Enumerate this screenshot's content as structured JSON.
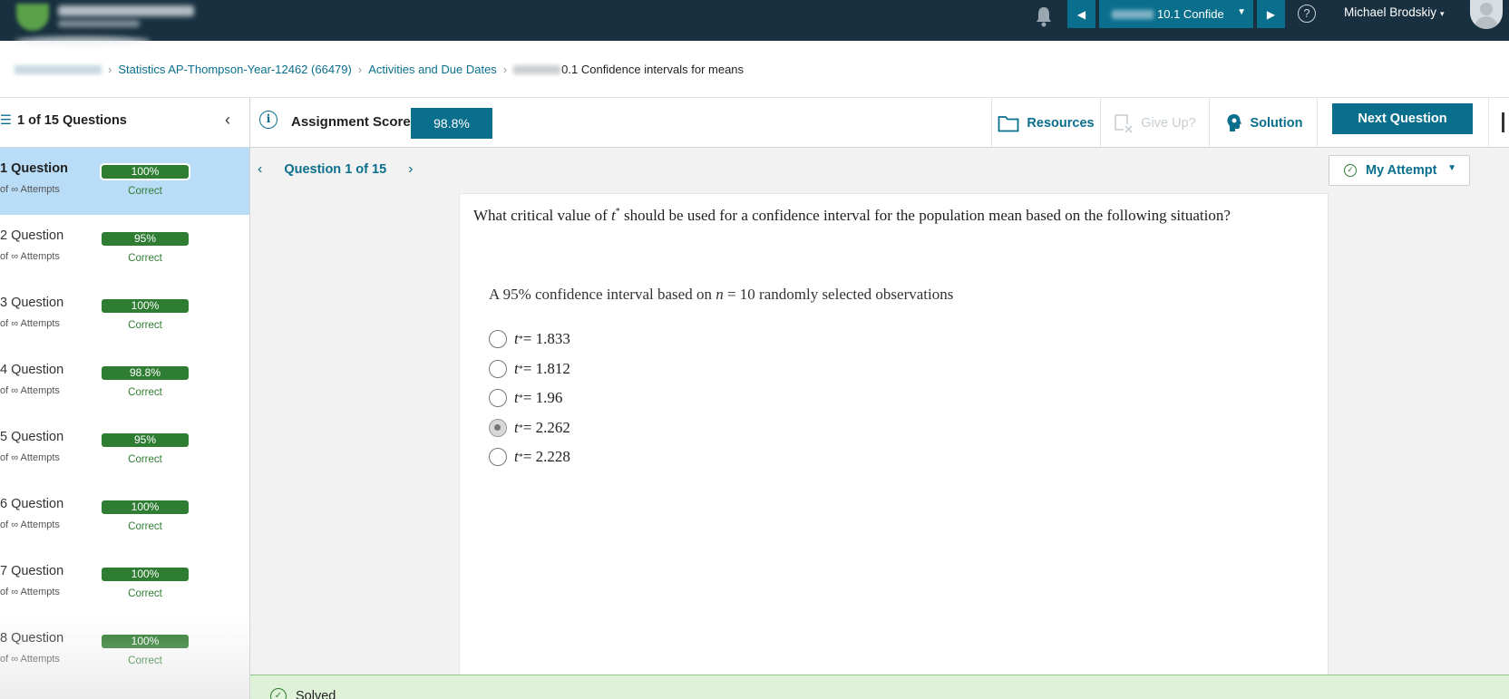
{
  "topbar": {
    "logo_name": "cengage-logo",
    "assignment_title": "10.1 Confide",
    "assignment_caret": "▼",
    "prev_icon": "◀",
    "next_icon": "▶",
    "help_icon": "?",
    "user_name": "Michael Brodskiy",
    "user_caret": "▾"
  },
  "breadcrumb": {
    "course": "Statistics AP-Thompson-Year-12462 (66479)",
    "activities": "Activities and Due Dates",
    "current": "0.1 Confidence intervals for means",
    "separator": "›"
  },
  "header": {
    "question_count": "1 of 15 Questions",
    "menu_icon": "☰",
    "collapse_icon": "‹",
    "info_icon": "i",
    "score_label": "Assignment Score:",
    "score_value": "98.8%",
    "resources_label": "Resources",
    "giveup_label": "Give Up?",
    "solution_label": "Solution",
    "next_question_label": "Next Question"
  },
  "sidebar": {
    "items": [
      {
        "name": "1 Question",
        "attempts": "of ∞ Attempts",
        "score": "100%",
        "status": "Correct"
      },
      {
        "name": "2 Question",
        "attempts": "of ∞ Attempts",
        "score": "95%",
        "status": "Correct"
      },
      {
        "name": "3 Question",
        "attempts": "of ∞ Attempts",
        "score": "100%",
        "status": "Correct"
      },
      {
        "name": "4 Question",
        "attempts": "of ∞ Attempts",
        "score": "98.8%",
        "status": "Correct"
      },
      {
        "name": "5 Question",
        "attempts": "of ∞ Attempts",
        "score": "95%",
        "status": "Correct"
      },
      {
        "name": "6 Question",
        "attempts": "of ∞ Attempts",
        "score": "100%",
        "status": "Correct"
      },
      {
        "name": "7 Question",
        "attempts": "of ∞ Attempts",
        "score": "100%",
        "status": "Correct"
      },
      {
        "name": "8 Question",
        "attempts": "of ∞ Attempts",
        "score": "100%",
        "status": "Correct"
      }
    ],
    "active_index": 0
  },
  "main": {
    "question_nav_label": "Question 1 of 15",
    "prev_chevron": "‹",
    "next_chevron": "›",
    "my_attempt_label": "My Attempt",
    "my_attempt_caret": "▼",
    "question_text_before": "What critical value of ",
    "question_var": "t",
    "question_sup": "*",
    "question_text_after": " should be used for a confidence interval for the population mean based on the following situation?",
    "situation_before": "A 95% confidence interval based on ",
    "situation_var": "n",
    "situation_after": " = 10 randomly selected observations",
    "options": [
      {
        "var": "t",
        "sup": "*",
        "value": " = 1.833",
        "selected": false
      },
      {
        "var": "t",
        "sup": "*",
        "value": " = 1.812",
        "selected": false
      },
      {
        "var": "t",
        "sup": "*",
        "value": " = 1.96",
        "selected": false
      },
      {
        "var": "t",
        "sup": "*",
        "value": " = 2.262",
        "selected": true
      },
      {
        "var": "t",
        "sup": "*",
        "value": " = 2.228",
        "selected": false
      }
    ],
    "solved_label": "Solved",
    "solved_icon": "✓"
  },
  "colors": {
    "topbar_bg": "#18303f",
    "accent": "#0a6f8d",
    "correct_green": "#2f7d32",
    "active_row": "#b9dcf7",
    "solved_bg": "#dff2d8"
  }
}
